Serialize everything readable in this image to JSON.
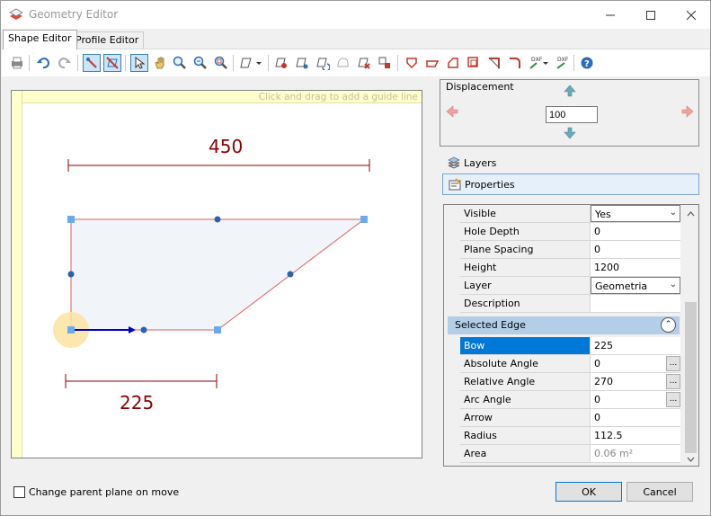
{
  "window": {
    "title": "Geometry Editor"
  },
  "tabs": [
    {
      "label": "Shape Editor",
      "active": true
    },
    {
      "label": "Profile Editor",
      "active": false
    }
  ],
  "canvas": {
    "hint": "Click and drag to add a guide line",
    "dimension_top": "450",
    "dimension_bottom": "225"
  },
  "displacement": {
    "title": "Displacement",
    "value": "100"
  },
  "accordion": {
    "layers": "Layers",
    "properties": "Properties"
  },
  "properties": {
    "rows": [
      {
        "name": "Visible",
        "value": "Yes"
      },
      {
        "name": "Hole Depth",
        "value": "0"
      },
      {
        "name": "Plane Spacing",
        "value": "0"
      },
      {
        "name": "Height",
        "value": "1200"
      },
      {
        "name": "Layer",
        "value": "Geometria"
      },
      {
        "name": "Description",
        "value": ""
      }
    ],
    "category": "Selected Edge",
    "edge_rows": [
      {
        "name": "Bow",
        "value": "225"
      },
      {
        "name": "Absolute Angle",
        "value": "0"
      },
      {
        "name": "Relative Angle",
        "value": "270"
      },
      {
        "name": "Arc Angle",
        "value": "0"
      },
      {
        "name": "Arrow",
        "value": "0"
      },
      {
        "name": "Radius",
        "value": "112.5"
      },
      {
        "name": "Area",
        "value": "0.06 m²"
      }
    ]
  },
  "footer": {
    "checkbox_label": "Change parent plane on move",
    "ok_label": "OK",
    "cancel_label": "Cancel"
  },
  "colors": {
    "dimension": "#8b0000",
    "shape_fill": "#f1f5fa",
    "shape_edge": "#e06060",
    "handle": "#6aaaf0",
    "selected_edge": "#0000c8",
    "highlight": "#fbe3a0"
  },
  "icons": [
    "print-icon",
    "undo-icon",
    "redo-icon",
    "snap-edit-icon",
    "snap-shape-icon",
    "pointer-icon",
    "pan-icon",
    "zoom-in-icon",
    "zoom-out-icon",
    "zoom-fit-icon",
    "draw-shape-icon",
    "add-point-icon",
    "edit-point-icon",
    "rotate-icon",
    "arc-icon",
    "delete-point-icon",
    "move-icon",
    "shape-a-icon",
    "shape-b-icon",
    "shape-c-icon",
    "shape-d-icon",
    "chamfer-icon",
    "fillet-icon",
    "import-dxf-icon",
    "export-dxf-icon",
    "help-icon"
  ]
}
